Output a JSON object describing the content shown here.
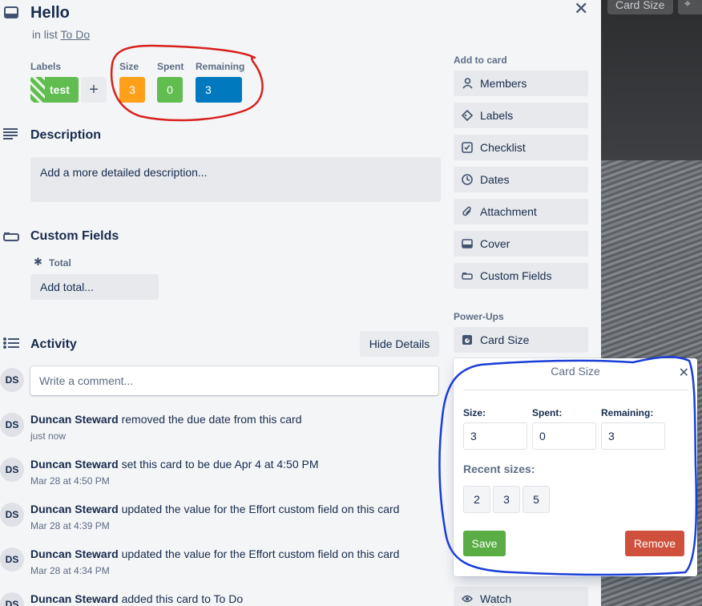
{
  "card": {
    "title": "Hello",
    "in_list_prefix": "in list",
    "list_name": "To Do"
  },
  "labels": {
    "heading": "Labels",
    "items": [
      {
        "text": "test",
        "color": "#61bd4f"
      }
    ],
    "add_symbol": "+"
  },
  "sizes": {
    "size_heading": "Size",
    "size_value": "3",
    "spent_heading": "Spent",
    "spent_value": "0",
    "remaining_heading": "Remaining",
    "remaining_value": "3",
    "colors": {
      "size": "#ff9f1a",
      "spent": "#61bd4f",
      "remaining": "#0079bf"
    }
  },
  "description": {
    "title": "Description",
    "placeholder": "Add a more detailed description..."
  },
  "custom_fields": {
    "title": "Custom Fields",
    "field_label": "Total",
    "field_placeholder": "Add total..."
  },
  "activity": {
    "title": "Activity",
    "hide_details": "Hide Details",
    "comment_placeholder": "Write a comment...",
    "avatar_initials": "DS",
    "entries": [
      {
        "user": "Duncan Steward",
        "action": "removed the due date from this card",
        "time": "just now"
      },
      {
        "user": "Duncan Steward",
        "action": "set this card to be due Apr 4 at 4:50 PM",
        "time": "Mar 28 at 4:50 PM"
      },
      {
        "user": "Duncan Steward",
        "action": "updated the value for the Effort custom field on this card",
        "time": "Mar 28 at 4:39 PM"
      },
      {
        "user": "Duncan Steward",
        "action": "updated the value for the Effort custom field on this card",
        "time": "Mar 28 at 4:34 PM"
      },
      {
        "user": "Duncan Steward",
        "action": "added this card to To Do",
        "time": ""
      }
    ]
  },
  "sidebar": {
    "add_to_card": "Add to card",
    "buttons": [
      {
        "label": "Members",
        "icon": "person-icon"
      },
      {
        "label": "Labels",
        "icon": "tag-icon"
      },
      {
        "label": "Checklist",
        "icon": "checklist-icon"
      },
      {
        "label": "Dates",
        "icon": "clock-icon"
      },
      {
        "label": "Attachment",
        "icon": "paperclip-icon"
      },
      {
        "label": "Cover",
        "icon": "cover-icon"
      },
      {
        "label": "Custom Fields",
        "icon": "custom-fields-icon"
      }
    ],
    "power_ups": "Power-Ups",
    "card_size": "Card Size",
    "watch": "Watch"
  },
  "popup": {
    "title": "Card Size",
    "size_label": "Size:",
    "size_value": "3",
    "spent_label": "Spent:",
    "spent_value": "0",
    "remaining_label": "Remaining:",
    "remaining_value": "3",
    "recent_label": "Recent sizes:",
    "recent": [
      "2",
      "3",
      "5"
    ],
    "save": "Save",
    "remove": "Remove",
    "save_color": "#5aac44",
    "remove_color": "#cf513d"
  },
  "backdrop": {
    "chip_label": "Card Size"
  }
}
